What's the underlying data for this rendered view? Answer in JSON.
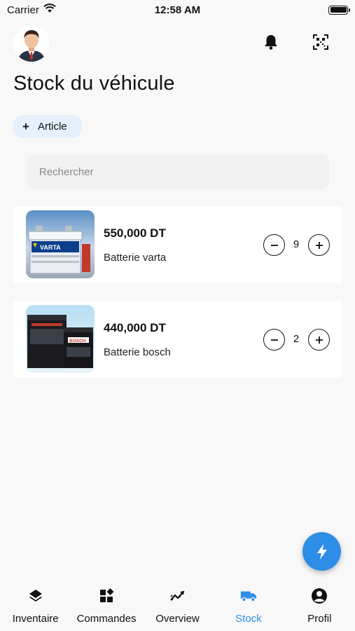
{
  "status_bar": {
    "carrier": "Carrier",
    "time": "12:58 AM"
  },
  "header": {
    "title": "Stock du véhicule",
    "add_article": {
      "icon": "plus-icon",
      "label": "Article"
    },
    "icons": [
      "bell-icon",
      "qr-scan-icon"
    ]
  },
  "search": {
    "placeholder": "Rechercher",
    "value": ""
  },
  "products": [
    {
      "price": "550,000 DT",
      "name": "Batterie varta",
      "quantity": "9",
      "brand_label": "VARTA"
    },
    {
      "price": "440,000 DT",
      "name": "Batterie bosch",
      "quantity": "2",
      "brand_label": "BOSCH"
    }
  ],
  "fab": {
    "icon": "lightning-icon"
  },
  "bottom_nav": {
    "items": [
      {
        "label": "Inventaire",
        "icon": "layers-icon"
      },
      {
        "label": "Commandes",
        "icon": "widgets-icon"
      },
      {
        "label": "Overview",
        "icon": "trend-icon"
      },
      {
        "label": "Stock",
        "icon": "truck-icon",
        "active": true
      },
      {
        "label": "Profil",
        "icon": "account-circle-icon"
      }
    ]
  },
  "colors": {
    "accent": "#2e8de6",
    "chip_bg": "#e4f0fb",
    "search_bg": "#f1f1f1",
    "background": "#f8f8f8"
  }
}
